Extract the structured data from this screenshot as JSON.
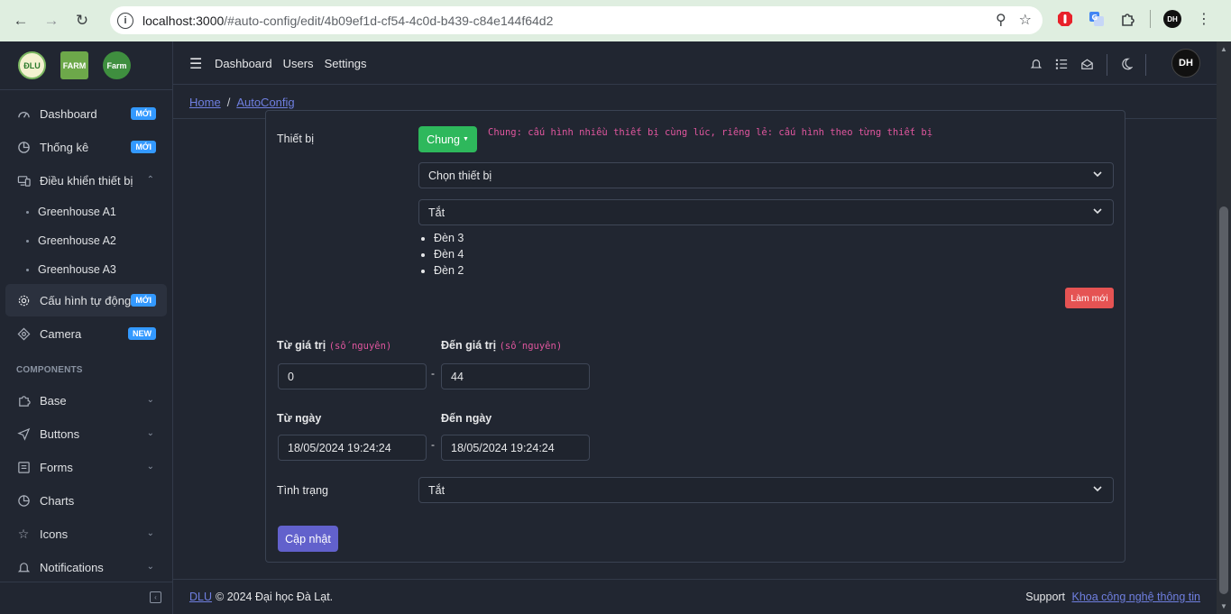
{
  "browser": {
    "url_host": "localhost:3000",
    "url_path": "/#auto-config/edit/4b09ef1d-cf54-4c0d-b439-c84e144f64d2"
  },
  "sidebar": {
    "logo_texts": [
      "ĐLU",
      "FARM",
      "Farm"
    ],
    "items": [
      {
        "label": "Dashboard",
        "badge": "MỚI"
      },
      {
        "label": "Thống kê",
        "badge": "MỚI"
      },
      {
        "label": "Điều khiển thiết bị"
      },
      {
        "label": "Cấu hình tự động",
        "badge": "MỚI"
      },
      {
        "label": "Camera",
        "badge": "NEW"
      }
    ],
    "sub_items": [
      "Greenhouse A1",
      "Greenhouse A2",
      "Greenhouse A3"
    ],
    "section_title": "COMPONENTS",
    "components": [
      "Base",
      "Buttons",
      "Forms",
      "Charts",
      "Icons",
      "Notifications"
    ]
  },
  "header": {
    "nav": [
      "Dashboard",
      "Users",
      "Settings"
    ],
    "avatar_text": "DH"
  },
  "breadcrumb": {
    "home": "Home",
    "separator": "/",
    "current": "AutoConfig"
  },
  "form": {
    "device_label": "Thiết bị",
    "mode_button": "Chung",
    "mode_note": "Chung: cấu hình nhiều thiết bị cùng lúc, riêng lẻ: cấu hình theo từng thiết bị",
    "device_select": "Chọn thiết bị",
    "state_select": "Tắt",
    "devices": [
      "Đèn 3",
      "Đèn 4",
      "Đèn 2"
    ],
    "reset_button": "Làm mới",
    "from_value_label": "Từ giá trị",
    "to_value_label": "Đến giá trị",
    "integer_hint": "(số nguyên)",
    "from_value": "0",
    "to_value": "44",
    "dash": "-",
    "from_date_label": "Từ ngày",
    "to_date_label": "Đến ngày",
    "from_date": "18/05/2024 19:24:24",
    "to_date": "18/05/2024 19:24:24",
    "status_label": "Tình trạng",
    "status_select": "Tắt",
    "submit_button": "Cập nhật"
  },
  "footer": {
    "link": "DLU",
    "copyright": "© 2024 Đại học Đà Lạt.",
    "support_label": "Support",
    "support_link": "Khoa công nghệ thông tin"
  }
}
